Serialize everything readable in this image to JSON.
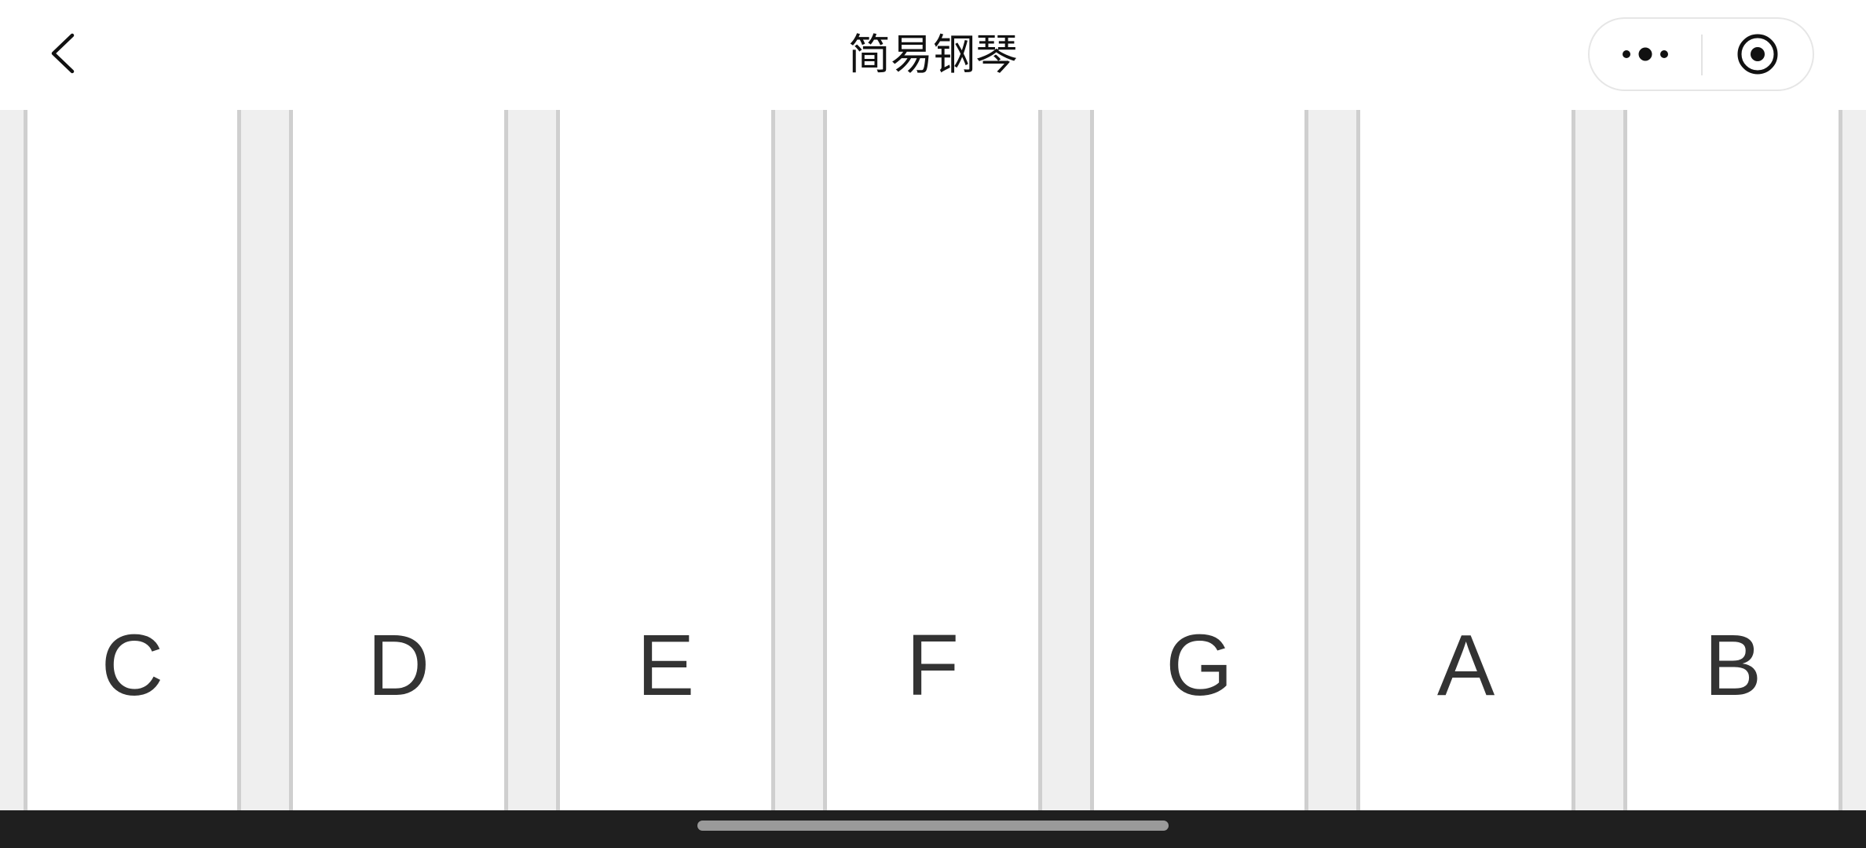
{
  "navbar": {
    "title": "简易钢琴",
    "back_icon": "chevron-left-icon",
    "more_icon": "more-dots-icon",
    "close_icon": "target-close-icon"
  },
  "keyboard": {
    "keys": [
      {
        "label": "C"
      },
      {
        "label": "D"
      },
      {
        "label": "E"
      },
      {
        "label": "F"
      },
      {
        "label": "G"
      },
      {
        "label": "A"
      },
      {
        "label": "B"
      }
    ]
  },
  "colors": {
    "key": "#ffffff",
    "gap": "#efefef",
    "gap_border": "#cfcfcf",
    "label": "#333333",
    "system_bar": "#1f1f1f"
  }
}
